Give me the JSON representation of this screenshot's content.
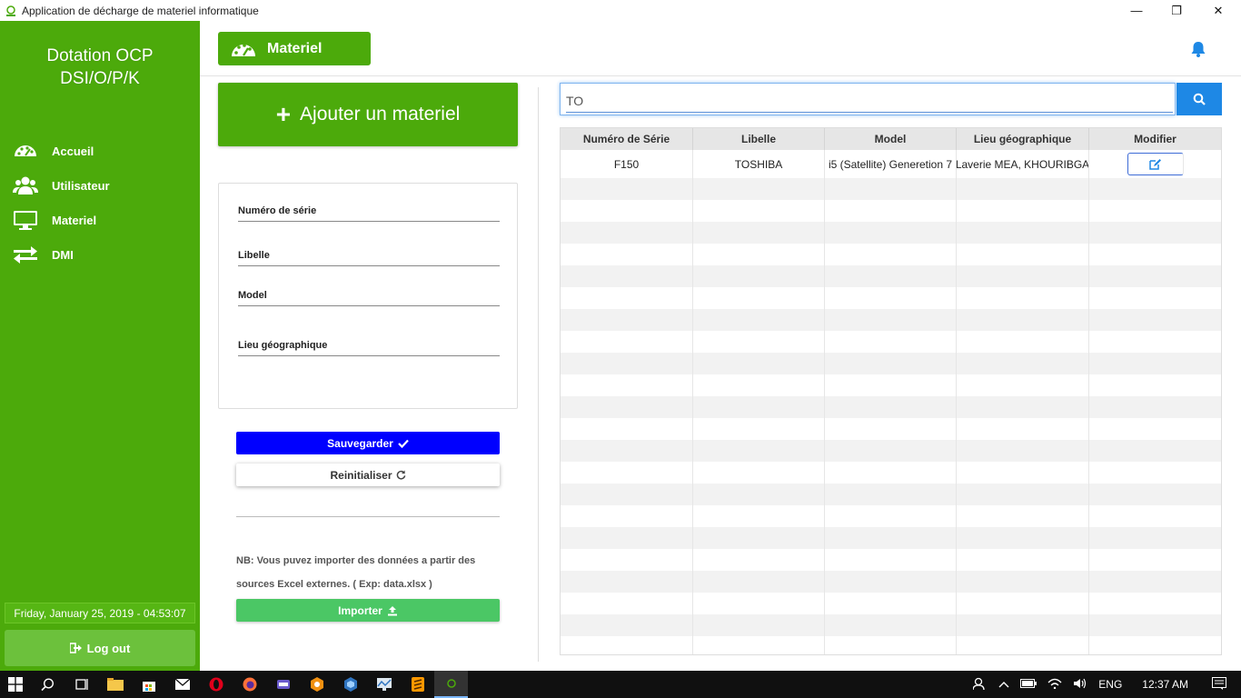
{
  "window": {
    "title": "Application de décharge de materiel informatique",
    "minimize": "—",
    "restore": "❐",
    "close": "✕"
  },
  "sidebar": {
    "brand_line1": "Dotation OCP",
    "brand_line2": "DSI/O/P/K",
    "items": [
      {
        "label": "Accueil",
        "icon": "dashboard-icon"
      },
      {
        "label": "Utilisateur",
        "icon": "users-icon"
      },
      {
        "label": "Materiel",
        "icon": "monitor-icon"
      },
      {
        "label": "DMI",
        "icon": "exchange-icon"
      }
    ],
    "datetime": "Friday, January 25, 2019 - 04:53:07",
    "logout_label": "Log out"
  },
  "header": {
    "title": "Materiel"
  },
  "form": {
    "add_label": "Ajouter un materiel",
    "fields": [
      "Numéro de série",
      "Libelle",
      "Model",
      "Lieu géographique"
    ],
    "save_label": "Sauvegarder",
    "reset_label": "Reinitialiser",
    "note_line1": "NB: Vous puvez importer des données a partir  des",
    "note_line2": "sources Excel externes. ( Exp: data.xlsx )",
    "import_label": "Importer"
  },
  "search": {
    "value": "TO"
  },
  "table": {
    "columns": [
      "Numéro de Série",
      "Libelle",
      "Model",
      "Lieu géographique",
      "Modifier"
    ],
    "rows": [
      [
        "F150",
        "TOSHIBA",
        "i5 (Satellite) Generetion 7",
        "Laverie MEA, KHOURIBGA"
      ]
    ]
  },
  "taskbar": {
    "lang": "ENG",
    "time": "12:37 AM"
  },
  "colors": {
    "brand_green": "#4caa0b",
    "save_blue": "#0000ff",
    "import_green": "#4bc765",
    "search_blue": "#1e88e5"
  }
}
